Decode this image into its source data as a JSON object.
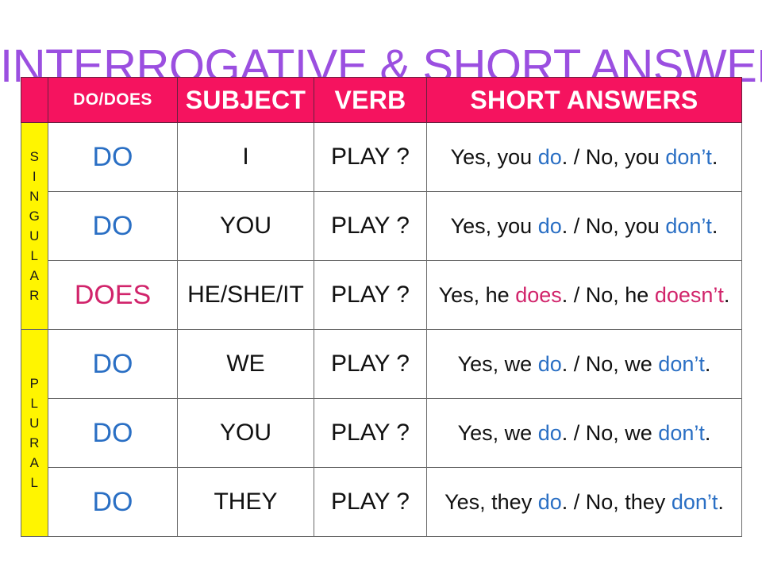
{
  "title": "INTERROGATIVE & SHORT ANSWERS",
  "colors": {
    "title_purple": "#9B4FE0",
    "header_pink": "#F5135F",
    "group_yellow": "#FFF500",
    "do_blue": "#2A6FC4",
    "does_pink": "#D1246B",
    "text_black": "#111111",
    "border_gray": "#6a6a6a"
  },
  "header": {
    "corner_label": "",
    "do_does": "DO/DOES",
    "subject": "SUBJECT",
    "verb": "VERB",
    "short_answers": "SHORT ANSWERS"
  },
  "groups": [
    {
      "label": "SINGULAR",
      "letters": [
        "S",
        "I",
        "N",
        "G",
        "U",
        "L",
        "A",
        "R"
      ],
      "rows": 3
    },
    {
      "label": "PLURAL",
      "letters": [
        "P",
        "L",
        "U",
        "R",
        "A",
        "L"
      ],
      "rows": 3
    }
  ],
  "rows": [
    {
      "group": "SINGULAR",
      "aux": "DO",
      "aux_color": "do",
      "subject": "I",
      "verb": "PLAY ?",
      "answer": {
        "full": "Yes, you do. / No, you don't.",
        "parts": [
          {
            "text": "Yes, you ",
            "style": "plain"
          },
          {
            "text": "do",
            "style": "do"
          },
          {
            "text": ". / No, you ",
            "style": "plain"
          },
          {
            "text": "don’t",
            "style": "do"
          },
          {
            "text": ".",
            "style": "plain"
          }
        ]
      }
    },
    {
      "group": "SINGULAR",
      "aux": "DO",
      "aux_color": "do",
      "subject": "YOU",
      "verb": "PLAY ?",
      "answer": {
        "full": "Yes, you do. / No, you don't.",
        "parts": [
          {
            "text": "Yes, you ",
            "style": "plain"
          },
          {
            "text": "do",
            "style": "do"
          },
          {
            "text": ". / No, you ",
            "style": "plain"
          },
          {
            "text": "don’t",
            "style": "do"
          },
          {
            "text": ".",
            "style": "plain"
          }
        ]
      }
    },
    {
      "group": "SINGULAR",
      "aux": "DOES",
      "aux_color": "does",
      "subject": "HE/SHE/IT",
      "verb": "PLAY ?",
      "answer": {
        "full": "Yes, he does. / No, he doesn't.",
        "parts": [
          {
            "text": "Yes, he ",
            "style": "plain"
          },
          {
            "text": "does",
            "style": "does"
          },
          {
            "text": ". / No, he ",
            "style": "plain"
          },
          {
            "text": "doesn’t",
            "style": "does"
          },
          {
            "text": ".",
            "style": "plain"
          }
        ]
      }
    },
    {
      "group": "PLURAL",
      "aux": "DO",
      "aux_color": "do",
      "subject": "WE",
      "verb": "PLAY ?",
      "answer": {
        "full": "Yes, we do. / No, we don't.",
        "parts": [
          {
            "text": "Yes, we ",
            "style": "plain"
          },
          {
            "text": "do",
            "style": "do"
          },
          {
            "text": ". / No, we ",
            "style": "plain"
          },
          {
            "text": "don’t",
            "style": "do"
          },
          {
            "text": ".",
            "style": "plain"
          }
        ]
      }
    },
    {
      "group": "PLURAL",
      "aux": "DO",
      "aux_color": "do",
      "subject": "YOU",
      "verb": "PLAY ?",
      "answer": {
        "full": "Yes, we do. / No, we don't.",
        "parts": [
          {
            "text": "Yes, we ",
            "style": "plain"
          },
          {
            "text": "do",
            "style": "do"
          },
          {
            "text": ". / No, we ",
            "style": "plain"
          },
          {
            "text": "don’t",
            "style": "do"
          },
          {
            "text": ".",
            "style": "plain"
          }
        ]
      }
    },
    {
      "group": "PLURAL",
      "aux": "DO",
      "aux_color": "do",
      "subject": "THEY",
      "verb": "PLAY ?",
      "answer": {
        "full": "Yes, they do. / No, they don't.",
        "parts": [
          {
            "text": "Yes, they ",
            "style": "plain"
          },
          {
            "text": "do",
            "style": "do"
          },
          {
            "text": ". / No, they ",
            "style": "plain"
          },
          {
            "text": "don’t",
            "style": "do"
          },
          {
            "text": ".",
            "style": "plain"
          }
        ]
      }
    }
  ]
}
